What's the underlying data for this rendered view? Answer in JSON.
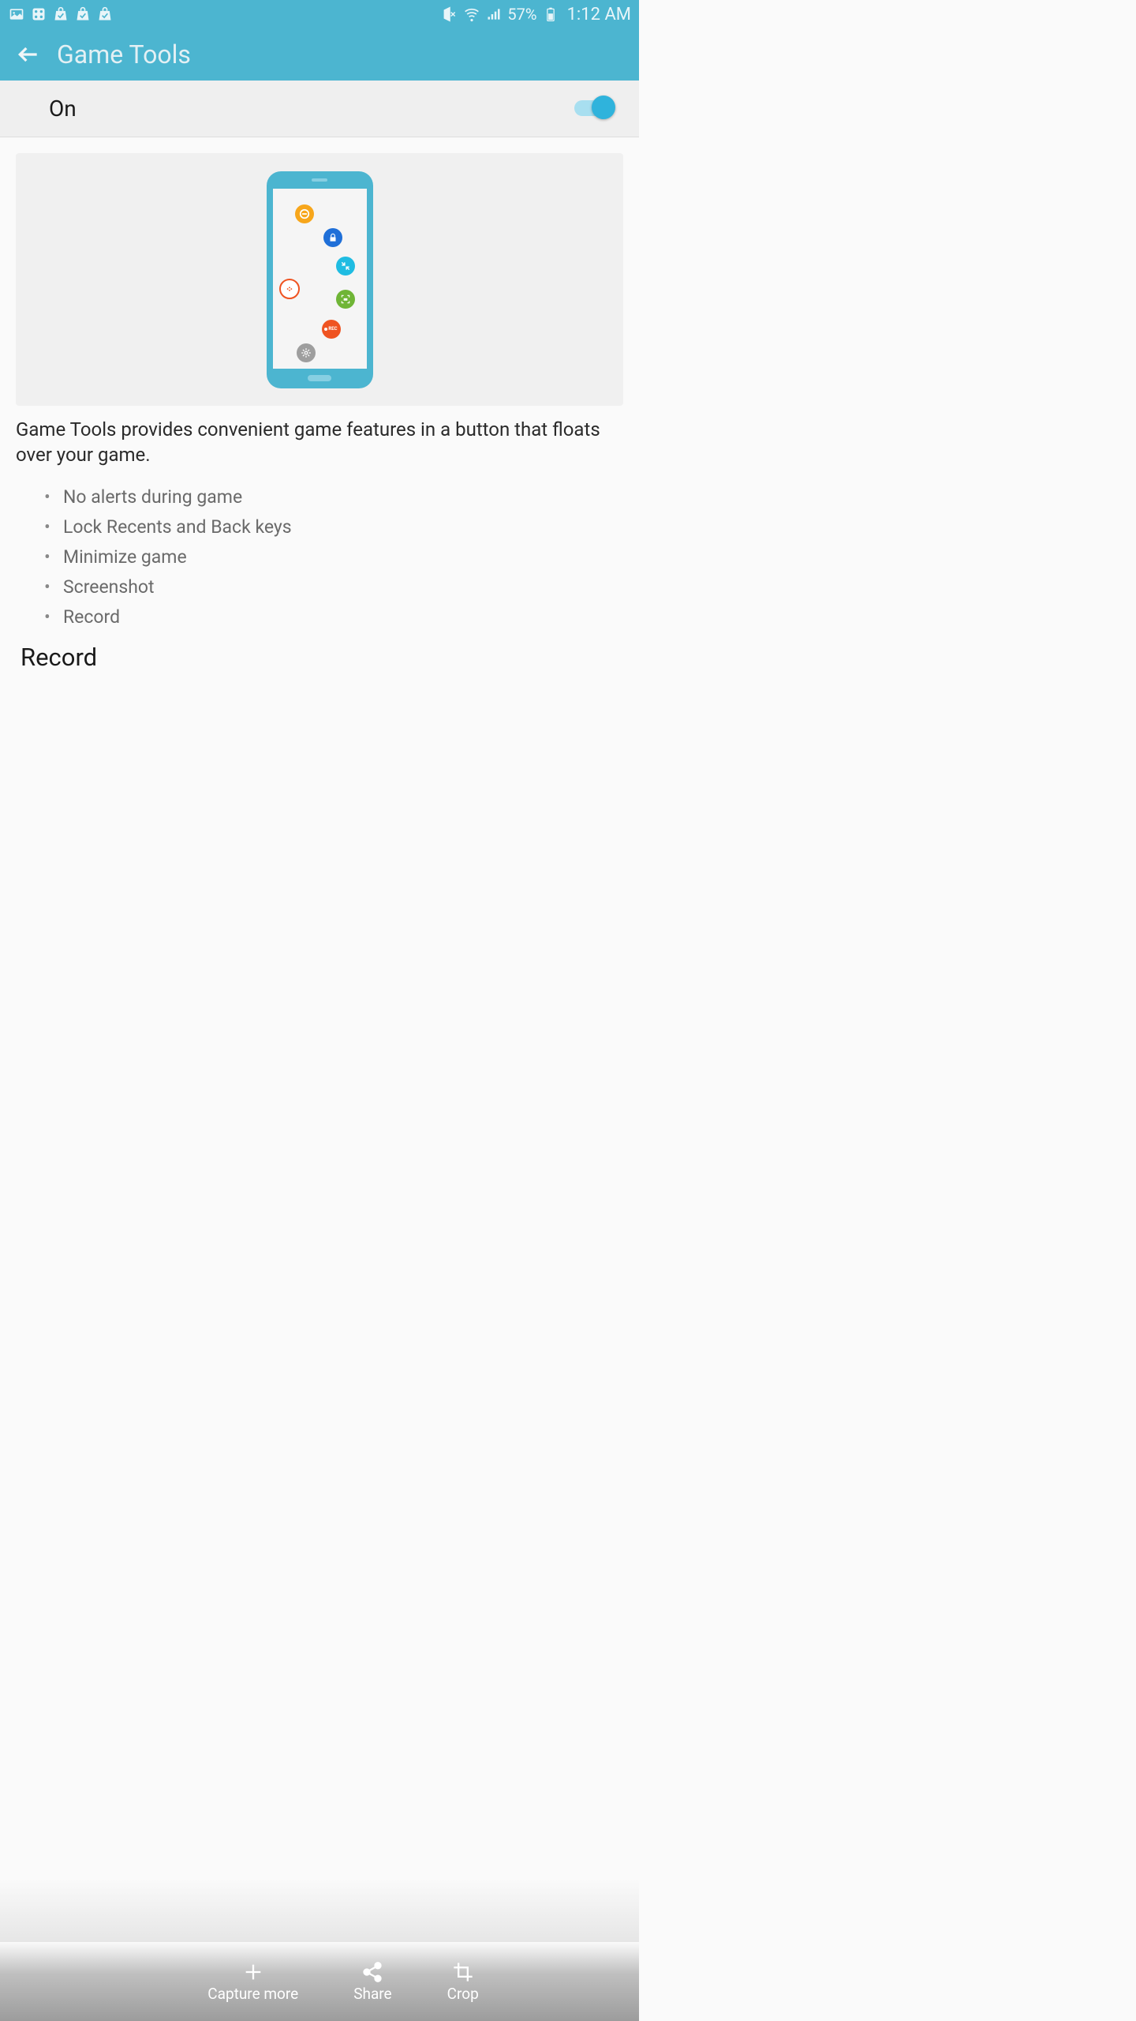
{
  "status": {
    "battery": "57%",
    "time": "1:12 AM"
  },
  "header": {
    "title": "Game Tools"
  },
  "toggle": {
    "label": "On",
    "state": true
  },
  "description": "Game Tools provides convenient game features in a button that floats over your game.",
  "features": [
    "No alerts during game",
    "Lock Recents and Back keys",
    "Minimize game",
    "Screenshot",
    "Record"
  ],
  "section_heading": "Record",
  "illustration": {
    "rec_label": "REC"
  },
  "actions": {
    "capture": "Capture more",
    "share": "Share",
    "crop": "Crop"
  }
}
